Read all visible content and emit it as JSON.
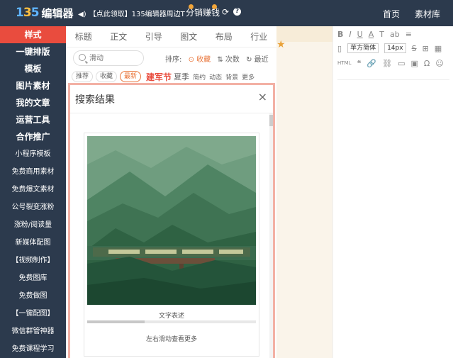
{
  "topbar": {
    "logo_number_a": "1",
    "logo_number_b": "3",
    "logo_number_c": "5",
    "logo_text": "编辑器",
    "promo": "【点此领取】135编辑器周边T",
    "fenxiao": "分销赚钱",
    "nav": [
      "首页",
      "素材库"
    ]
  },
  "sidebar": {
    "big_items": [
      "样式",
      "一键排版",
      "模板",
      "图片素材",
      "我的文章",
      "运营工具",
      "合作推广"
    ],
    "small_items": [
      "小程序模板",
      "免费商用素材",
      "免费爆文素材",
      "公号裂变涨粉",
      "涨粉/阅读量",
      "新媒体配图",
      "【视频制作】",
      "免费图库",
      "免费做图",
      "【一键配图】",
      "微信群管神器",
      "免费课程学习"
    ]
  },
  "panel": {
    "tabs": [
      "标题",
      "正文",
      "引导",
      "图文",
      "布局",
      "行业"
    ],
    "search_placeholder": "滑动",
    "sort_label": "排序:",
    "sort_options": [
      "收藏",
      "次数",
      "最近"
    ],
    "subtabs": [
      "推荐",
      "收藏",
      "最新"
    ],
    "hot": "建军节",
    "summer": "夏季",
    "more_tabs": [
      "简约",
      "动态",
      "背景",
      "更多"
    ]
  },
  "modal": {
    "title": "搜索结果",
    "close": "×",
    "caption": "文字表述",
    "hint": "左右滑动查看更多",
    "progress": 0.34
  },
  "editor": {
    "row1": [
      "B",
      "I",
      "U",
      "A",
      "T",
      "ab",
      "≡"
    ],
    "font_family": "苹方简体",
    "font_size": "14px",
    "row2_icons": [
      "S",
      "⊞",
      "▦"
    ],
    "row3": [
      "HTML",
      "❝",
      "🔗",
      "⛓",
      "▭",
      "▣",
      "Ω",
      "☺"
    ]
  },
  "colors": {
    "topbar": "#2c3a4d",
    "active": "#e94c3e",
    "accent": "#e9753a",
    "modal_border": "#f3b1a5"
  }
}
